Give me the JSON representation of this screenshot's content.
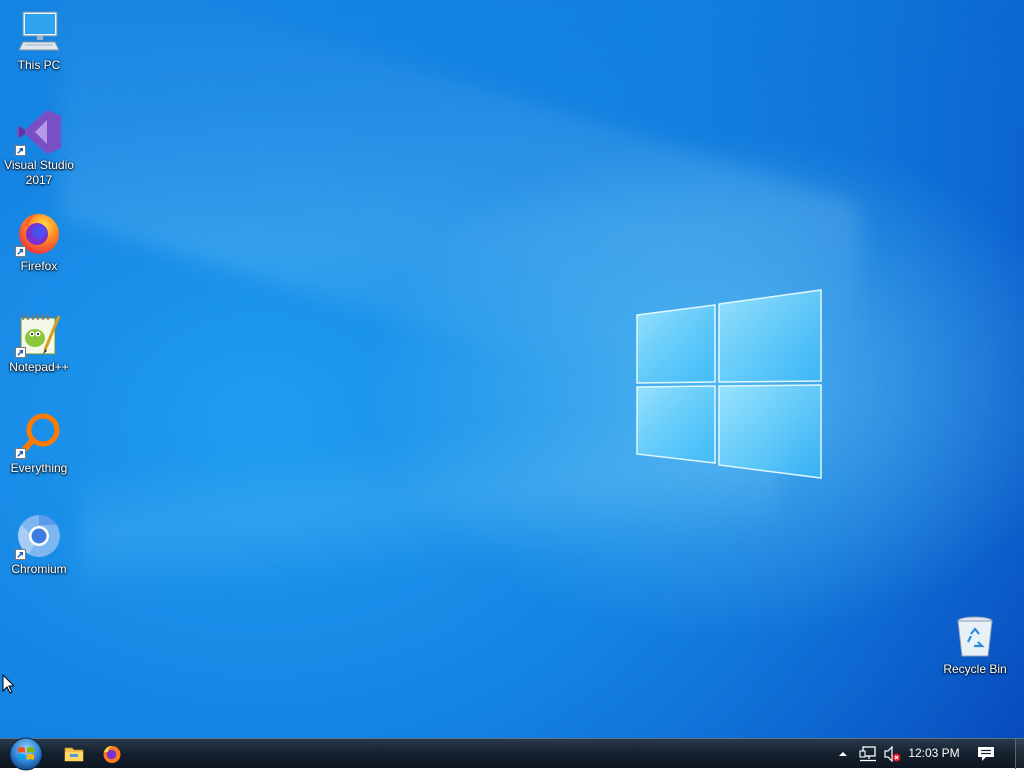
{
  "desktop": {
    "icons": [
      {
        "label": "This PC",
        "icon": "computer-icon",
        "shortcut": false
      },
      {
        "label": "Visual Studio 2017",
        "icon": "visual-studio-icon",
        "shortcut": true
      },
      {
        "label": "Firefox",
        "icon": "firefox-icon",
        "shortcut": true
      },
      {
        "label": "Notepad++",
        "icon": "notepad-plus-plus-icon",
        "shortcut": true
      },
      {
        "label": "Everything",
        "icon": "everything-search-icon",
        "shortcut": true
      },
      {
        "label": "Chromium",
        "icon": "chromium-icon",
        "shortcut": true
      }
    ],
    "recycle_bin": {
      "label": "Recycle Bin",
      "icon": "recycle-bin-icon"
    }
  },
  "taskbar": {
    "start": {
      "icon": "windows-start-orb-icon"
    },
    "pinned": [
      {
        "icon": "file-explorer-icon"
      },
      {
        "icon": "firefox-icon"
      }
    ],
    "tray": {
      "icons": [
        "chevron-up-icon",
        "network-icon",
        "volume-muted-icon"
      ],
      "clock": "12:03 PM",
      "notification_icon": "action-center-icon"
    }
  },
  "colors": {
    "wallpaper_blue": "#1584e3",
    "taskbar_dark": "#162230",
    "label_text": "#ffffff"
  }
}
